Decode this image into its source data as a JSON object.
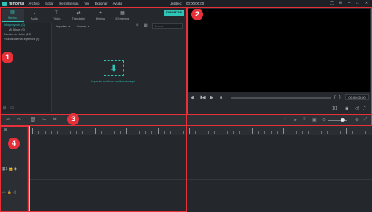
{
  "app": {
    "logo_text": "filmora9",
    "menu": [
      "Archivo",
      "Editar",
      "Herramientas",
      "Ver",
      "Exportar",
      "Ayuda"
    ],
    "doc_title": "Untitled:",
    "doc_time": "00:00:00:00"
  },
  "media": {
    "tabs": [
      {
        "label": "Medios",
        "icon": "folder-icon",
        "glyph": "▤"
      },
      {
        "label": "Audio",
        "icon": "music-note-icon",
        "glyph": "♪"
      },
      {
        "label": "Títulos",
        "icon": "text-icon",
        "glyph": "T"
      },
      {
        "label": "Transición",
        "icon": "transition-icon",
        "glyph": "⇄"
      },
      {
        "label": "Efectos",
        "icon": "effects-icon",
        "glyph": "✦"
      },
      {
        "label": "Elementos",
        "icon": "elements-icon",
        "glyph": "▦"
      }
    ],
    "export_label": "EXPORTAR",
    "sidebar": [
      {
        "label": "Info proyecto (0)",
        "level": 0
      },
      {
        "label": "Mi Álbum (0)",
        "level": 1
      },
      {
        "label": "Fondos de Color (13)",
        "level": 0
      },
      {
        "label": "Vídeos cuenta regresiva (9)",
        "level": 0
      }
    ],
    "toolbar": {
      "import_label": "Importar",
      "record_label": "Grabar",
      "search_placeholder": "Buscar"
    },
    "drop_label": "Importar archivos multimedia aquí"
  },
  "preview": {
    "time": "00:00:00:00",
    "zoom_label": "1/1"
  },
  "badges": [
    "1",
    "2",
    "3",
    "4"
  ]
}
